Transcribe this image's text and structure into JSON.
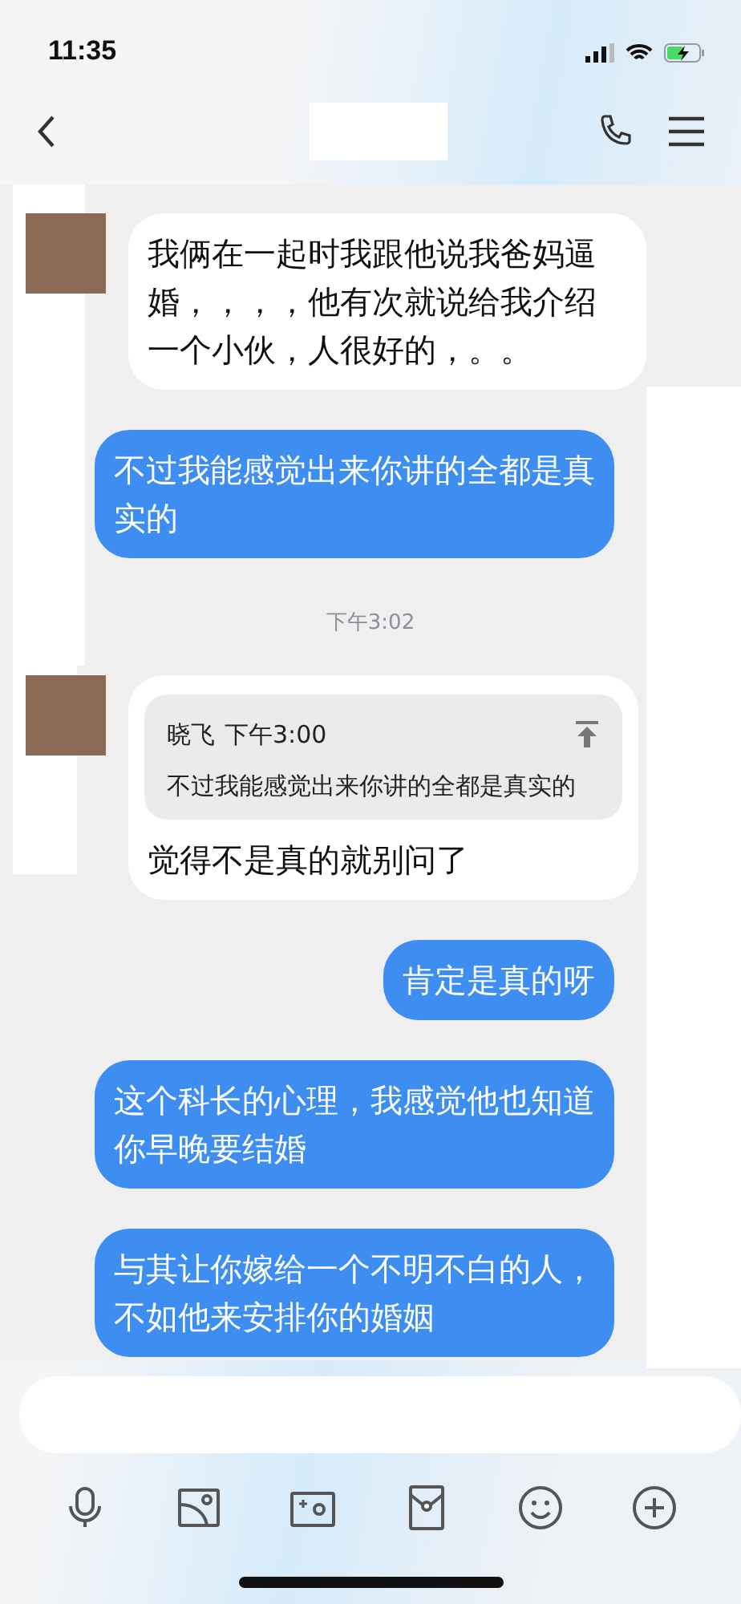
{
  "status_bar": {
    "time": "11:35",
    "battery_charging": true
  },
  "messages": [
    {
      "kind": "incoming",
      "text": "我俩在一起时我跟他说我爸妈逼婚，，，，他有次就说给我介绍一个小伙，人很好的，。。"
    },
    {
      "kind": "outgoing",
      "text": "不过我能感觉出来你讲的全都是真实的"
    },
    {
      "kind": "time",
      "text": "下午3:02"
    },
    {
      "kind": "incoming",
      "quote": {
        "sender": "晓飞",
        "time": "下午3:00",
        "text": "不过我能感觉出来你讲的全都是真实的"
      },
      "text": "觉得不是真的就别问了"
    },
    {
      "kind": "outgoing",
      "text": "肯定是真的呀"
    },
    {
      "kind": "outgoing",
      "text": "这个科长的心理，我感觉他也知道你早晚要结婚"
    },
    {
      "kind": "outgoing",
      "text": "与其让你嫁给一个不明不白的人，不如他来安排你的婚姻"
    }
  ],
  "toolbar": [
    {
      "kind": "mic"
    },
    {
      "kind": "image"
    },
    {
      "kind": "camera"
    },
    {
      "kind": "red-packet"
    },
    {
      "kind": "emoji"
    },
    {
      "kind": "plus"
    }
  ]
}
